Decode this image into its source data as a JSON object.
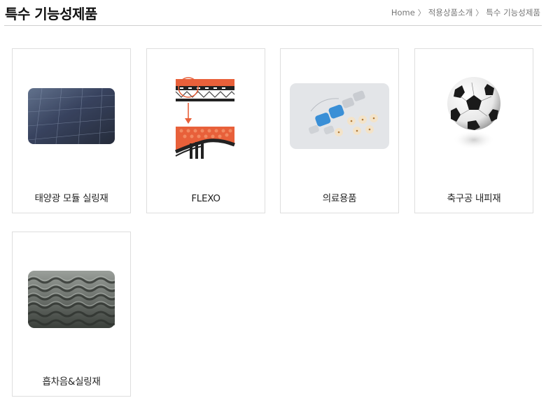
{
  "page": {
    "title": "특수 기능성제품"
  },
  "breadcrumb": [
    {
      "label": "Home"
    },
    {
      "label": "적용상품소개"
    },
    {
      "label": "특수 기능성제품"
    }
  ],
  "breadcrumb_separator": "〉",
  "products": [
    {
      "label": "태양광 모듈 실링재",
      "icon": "solar-panel-image"
    },
    {
      "label": "FLEXO",
      "icon": "flexo-diagram-image"
    },
    {
      "label": "의료용품",
      "icon": "medical-pads-image"
    },
    {
      "label": "축구공 내피재",
      "icon": "soccer-ball-image"
    },
    {
      "label": "흡차음&실링재",
      "icon": "acoustic-foam-image"
    }
  ]
}
